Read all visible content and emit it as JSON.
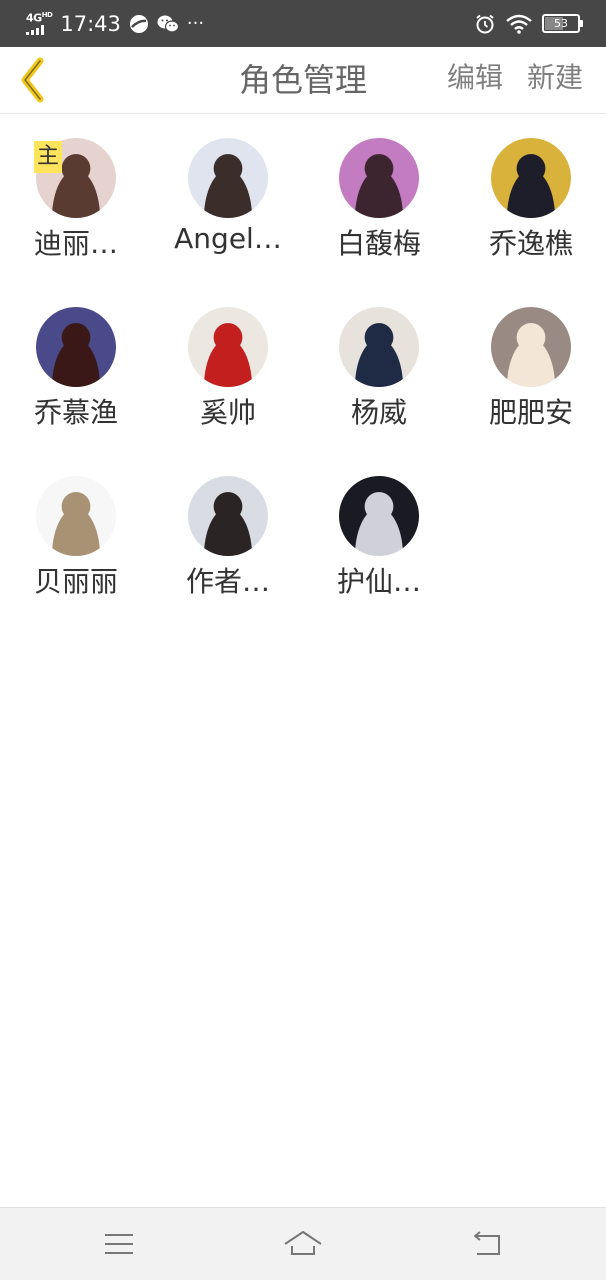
{
  "status_bar": {
    "network": "4G",
    "network_sup": "HD",
    "time": "17:43",
    "extra_dots": "···",
    "battery": "53",
    "battery_level": 0.53
  },
  "header": {
    "title": "角色管理",
    "edit_label": "编辑",
    "new_label": "新建"
  },
  "roles": [
    {
      "name": "迪丽…",
      "badge": "主",
      "avatar_colors": [
        "#e6d3cf",
        "#5a3b32"
      ]
    },
    {
      "name": "Angel…",
      "avatar_colors": [
        "#dfe4ee",
        "#3a2d2a"
      ]
    },
    {
      "name": "白馥梅",
      "avatar_colors": [
        "#c37bc2",
        "#3d2530"
      ]
    },
    {
      "name": "乔逸樵",
      "avatar_colors": [
        "#d9b23c",
        "#1e1e2a"
      ]
    },
    {
      "name": "乔慕渔",
      "avatar_colors": [
        "#4a4a8a",
        "#3a1818"
      ]
    },
    {
      "name": "奚帅",
      "avatar_colors": [
        "#ece7e0",
        "#c41f1f"
      ]
    },
    {
      "name": "杨威",
      "avatar_colors": [
        "#e8e2dc",
        "#1f2a44"
      ]
    },
    {
      "name": "肥肥安",
      "avatar_colors": [
        "#9a8a84",
        "#f3e6d6"
      ]
    },
    {
      "name": "贝丽丽",
      "avatar_colors": [
        "#f7f7f7",
        "#a99273"
      ]
    },
    {
      "name": "作者…",
      "avatar_colors": [
        "#d9dce2",
        "#2b2424"
      ]
    },
    {
      "name": "护仙…",
      "avatar_colors": [
        "#1a1a22",
        "#d0d0d8"
      ]
    }
  ],
  "colors": {
    "accent_yellow": "#f2c81e",
    "title_gray": "#666666",
    "status_bar_bg": "#474747"
  }
}
